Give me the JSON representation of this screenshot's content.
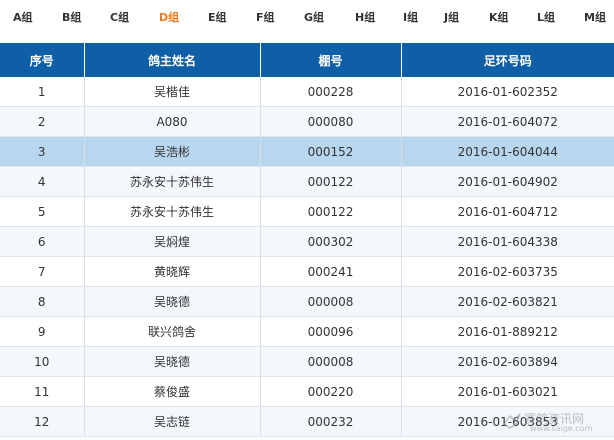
{
  "group_tabs": [
    {
      "label": "A组",
      "active": false
    },
    {
      "label": "B组",
      "active": false
    },
    {
      "label": "C组",
      "active": false
    },
    {
      "label": "D组",
      "active": true
    },
    {
      "label": "E组",
      "active": false
    },
    {
      "label": "F组",
      "active": false
    },
    {
      "label": "G组",
      "active": false
    },
    {
      "label": "H组",
      "active": false
    },
    {
      "label": "I组",
      "active": false
    },
    {
      "label": "J组",
      "active": false
    },
    {
      "label": "K组",
      "active": false
    },
    {
      "label": "L组",
      "active": false
    },
    {
      "label": "M组",
      "active": false
    }
  ],
  "colors": {
    "header_bg": "#0f5fa7",
    "active_tab": "#f07a1c",
    "selected_row": "#b8d7ee",
    "stripe_row": "#f4f8fc"
  },
  "table": {
    "headers": {
      "index": "序号",
      "owner": "鸽主姓名",
      "loft": "棚号",
      "ring": "足环号码"
    },
    "selected_row": 2,
    "rows": [
      {
        "index": "1",
        "owner": "吴楷佳",
        "loft": "000228",
        "ring": "2016-01-602352"
      },
      {
        "index": "2",
        "owner": "A080",
        "loft": "000080",
        "ring": "2016-01-604072"
      },
      {
        "index": "3",
        "owner": "吴浩彬",
        "loft": "000152",
        "ring": "2016-01-604044"
      },
      {
        "index": "4",
        "owner": "苏永安十苏伟生",
        "loft": "000122",
        "ring": "2016-01-604902"
      },
      {
        "index": "5",
        "owner": "苏永安十苏伟生",
        "loft": "000122",
        "ring": "2016-01-604712"
      },
      {
        "index": "6",
        "owner": "吴焖煌",
        "loft": "000302",
        "ring": "2016-01-604338"
      },
      {
        "index": "7",
        "owner": "黄晓辉",
        "loft": "000241",
        "ring": "2016-02-603735"
      },
      {
        "index": "8",
        "owner": "吴晓德",
        "loft": "000008",
        "ring": "2016-02-603821"
      },
      {
        "index": "9",
        "owner": "联兴鸽舍",
        "loft": "000096",
        "ring": "2016-01-889212"
      },
      {
        "index": "10",
        "owner": "吴晓德",
        "loft": "000008",
        "ring": "2016-02-603894"
      },
      {
        "index": "11",
        "owner": "蔡俊盛",
        "loft": "000220",
        "ring": "2016-01-603021"
      },
      {
        "index": "12",
        "owner": "吴志链",
        "loft": "000232",
        "ring": "2016-01-603853"
      }
    ]
  },
  "watermark": {
    "text": "赛鸽资讯网",
    "url": "www.saige.com"
  }
}
